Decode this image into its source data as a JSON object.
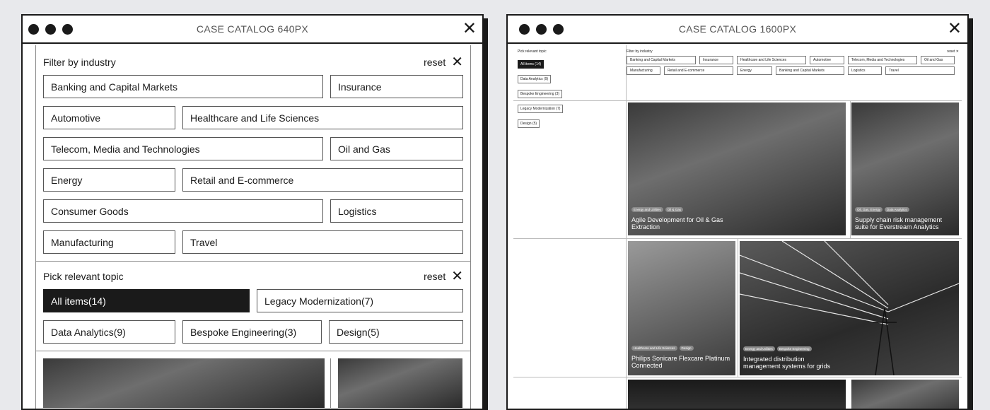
{
  "window1": {
    "title": "CASE CATALOG 640PX",
    "close": "✕",
    "industry": {
      "heading": "Filter by industry",
      "reset": "reset",
      "rows": [
        [
          "Banking and Capital Markets",
          "Insurance"
        ],
        [
          "Automotive",
          "Healthcare and Life Sciences"
        ],
        [
          "Telecom, Media and Technologies",
          "Oil and Gas"
        ],
        [
          "Energy",
          "Retail and E-commerce"
        ],
        [
          "Consumer Goods",
          "Logistics"
        ],
        [
          "Manufacturing",
          "Travel"
        ]
      ]
    },
    "topic": {
      "heading": "Pick relevant topic",
      "reset": "reset",
      "rows": [
        [
          "All items(14)",
          "Legacy Modernization(7)"
        ],
        [
          "Data Analytics(9)",
          "Bespoke Engineering(3)",
          "Design(5)"
        ]
      ]
    }
  },
  "window2": {
    "title": "CASE CATALOG 1600PX",
    "close": "✕",
    "sidebar": {
      "heading": "Pick relevant topic",
      "items": [
        "All items (14)",
        "Data Analytics (9)",
        "Bespoke Engineering (3)",
        "Legacy Modernization (7)",
        "Design (5)"
      ]
    },
    "filter": {
      "heading": "Filter by industry",
      "reset": "reset",
      "rows": [
        [
          "Banking and Capital Markets",
          "Insurance",
          "Healthcare and Life Sciences",
          "Automotive",
          "Telecom, Media and Technologies",
          "Oil and Gas"
        ],
        [
          "Manufacturing",
          "Retail and E-commerce",
          "Energy",
          "Banking and Capital Markets",
          "Logistics",
          "Travel"
        ]
      ]
    },
    "cards": [
      {
        "tags": [
          "Energy and Utilities",
          "Oil & Gas"
        ],
        "title1": "Agile Development for Oil & Gas",
        "title2": "Extraction"
      },
      {
        "tags": [
          "Oil, Gas, Energy",
          "Data Analytics"
        ],
        "title1": "Supply chain risk management",
        "title2": "suite for Everstream Analytics"
      },
      {
        "tags": [
          "Healthcare and Life Sciences",
          "Design"
        ],
        "title1": "Philips Sonicare Flexcare Platinum",
        "title2": "Connected"
      },
      {
        "tags": [
          "Energy and Utilities",
          "Bespoke Engineering"
        ],
        "title1": "Integrated distribution",
        "title2": "management systems for grids"
      }
    ]
  }
}
